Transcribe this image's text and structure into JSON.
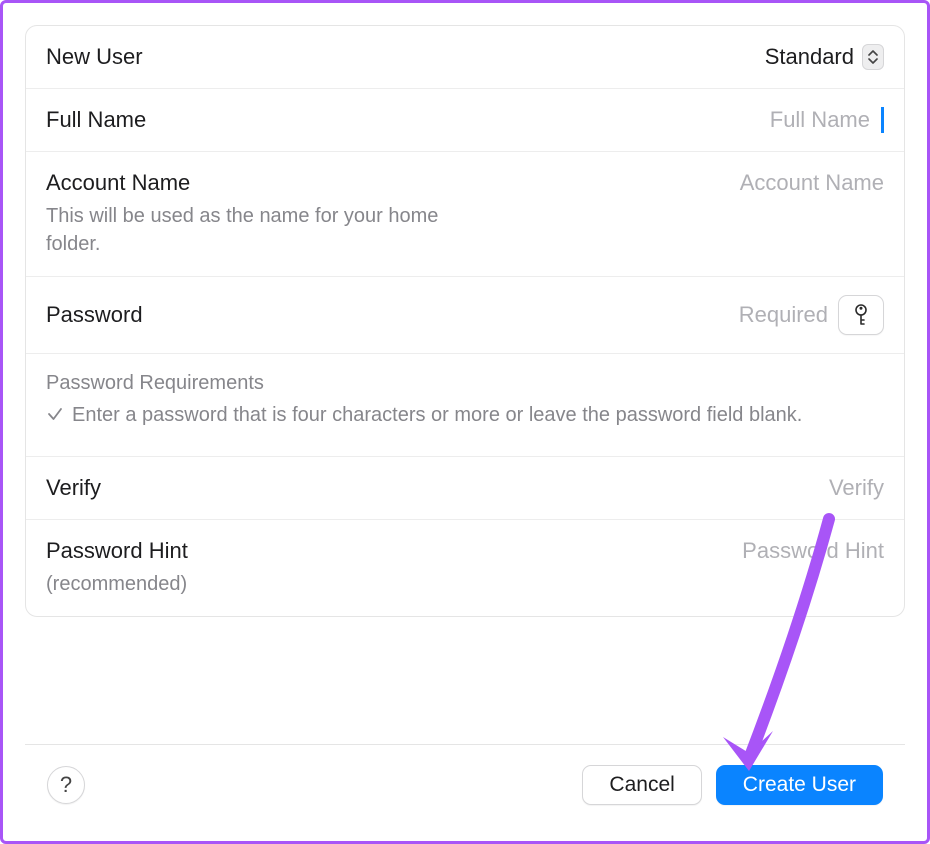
{
  "header": {
    "title": "New User",
    "type_selected": "Standard"
  },
  "fields": {
    "full_name": {
      "label": "Full Name",
      "placeholder": "Full Name",
      "value": ""
    },
    "account_name": {
      "label": "Account Name",
      "sublabel": "This will be used as the name for your home folder.",
      "placeholder": "Account Name",
      "value": ""
    },
    "password": {
      "label": "Password",
      "placeholder": "Required",
      "value": ""
    },
    "verify": {
      "label": "Verify",
      "placeholder": "Verify",
      "value": ""
    },
    "hint": {
      "label": "Password Hint",
      "sublabel": "(recommended)",
      "placeholder": "Password Hint",
      "value": ""
    }
  },
  "requirements": {
    "title": "Password Requirements",
    "items": [
      "Enter a password that is four characters or more or leave the password field blank."
    ]
  },
  "footer": {
    "help": "?",
    "cancel": "Cancel",
    "create": "Create User"
  },
  "colors": {
    "accent": "#0a84ff",
    "annotation": "#a855f7"
  }
}
